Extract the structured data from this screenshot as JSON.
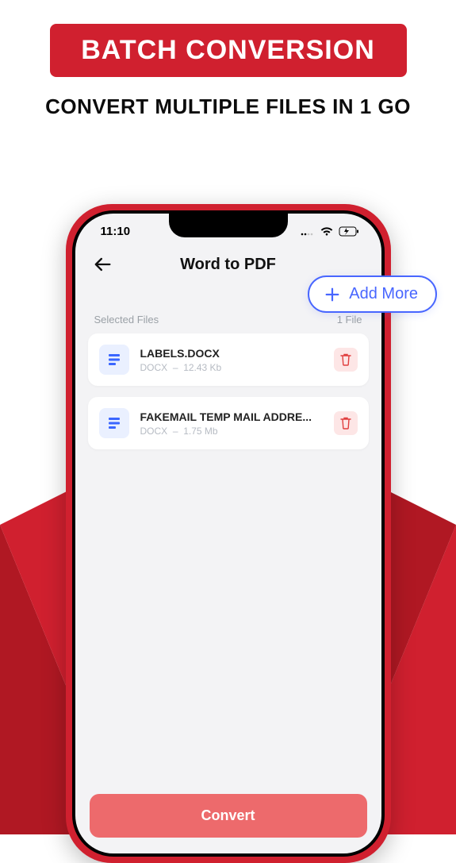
{
  "marketing": {
    "banner": "BATCH CONVERSION",
    "subtitle": "CONVERT MULTIPLE FILES IN 1 GO"
  },
  "status": {
    "time": "11:10"
  },
  "header": {
    "title": "Word to PDF",
    "add_more": "Add More"
  },
  "section": {
    "label": "Selected Files",
    "count": "1 File"
  },
  "files": [
    {
      "name": "LABELS.DOCX",
      "type": "DOCX",
      "size": "12.43 Kb"
    },
    {
      "name": "FAKEMAIL  TEMP MAIL ADDRE...",
      "type": "DOCX",
      "size": "1.75 Mb"
    }
  ],
  "actions": {
    "convert": "Convert"
  }
}
